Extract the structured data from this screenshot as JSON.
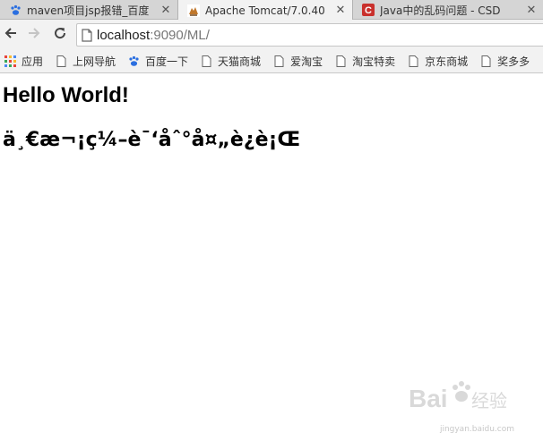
{
  "tabs": [
    {
      "title": "maven项目jsp报错_百度",
      "favicon": "baidu-paw-icon"
    },
    {
      "title": "Apache Tomcat/7.0.40",
      "favicon": "tomcat-icon",
      "active": true
    },
    {
      "title": "Java中的乱码问题 - CSD",
      "favicon": "csdn-icon"
    }
  ],
  "address": {
    "host": "localhost",
    "rest": ":9090/ML/"
  },
  "bookmarks": [
    {
      "label": "应用",
      "icon": "apps-grid-icon"
    },
    {
      "label": "上网导航",
      "icon": "page-icon"
    },
    {
      "label": "百度一下",
      "icon": "baidu-paw-icon"
    },
    {
      "label": "天猫商城",
      "icon": "page-icon"
    },
    {
      "label": "爱淘宝",
      "icon": "page-icon"
    },
    {
      "label": "淘宝特卖",
      "icon": "page-icon"
    },
    {
      "label": "京东商城",
      "icon": "page-icon"
    },
    {
      "label": "奖多多",
      "icon": "page-icon"
    }
  ],
  "page": {
    "heading": "Hello World!",
    "garbled": "ä¸€æ¬¡ç¼–è¯‘åˆ°å¤„è¿è¡Œ"
  },
  "watermark": {
    "brand": "Bai",
    "brand2": "经验",
    "sub": "jingyan.baidu.com"
  }
}
